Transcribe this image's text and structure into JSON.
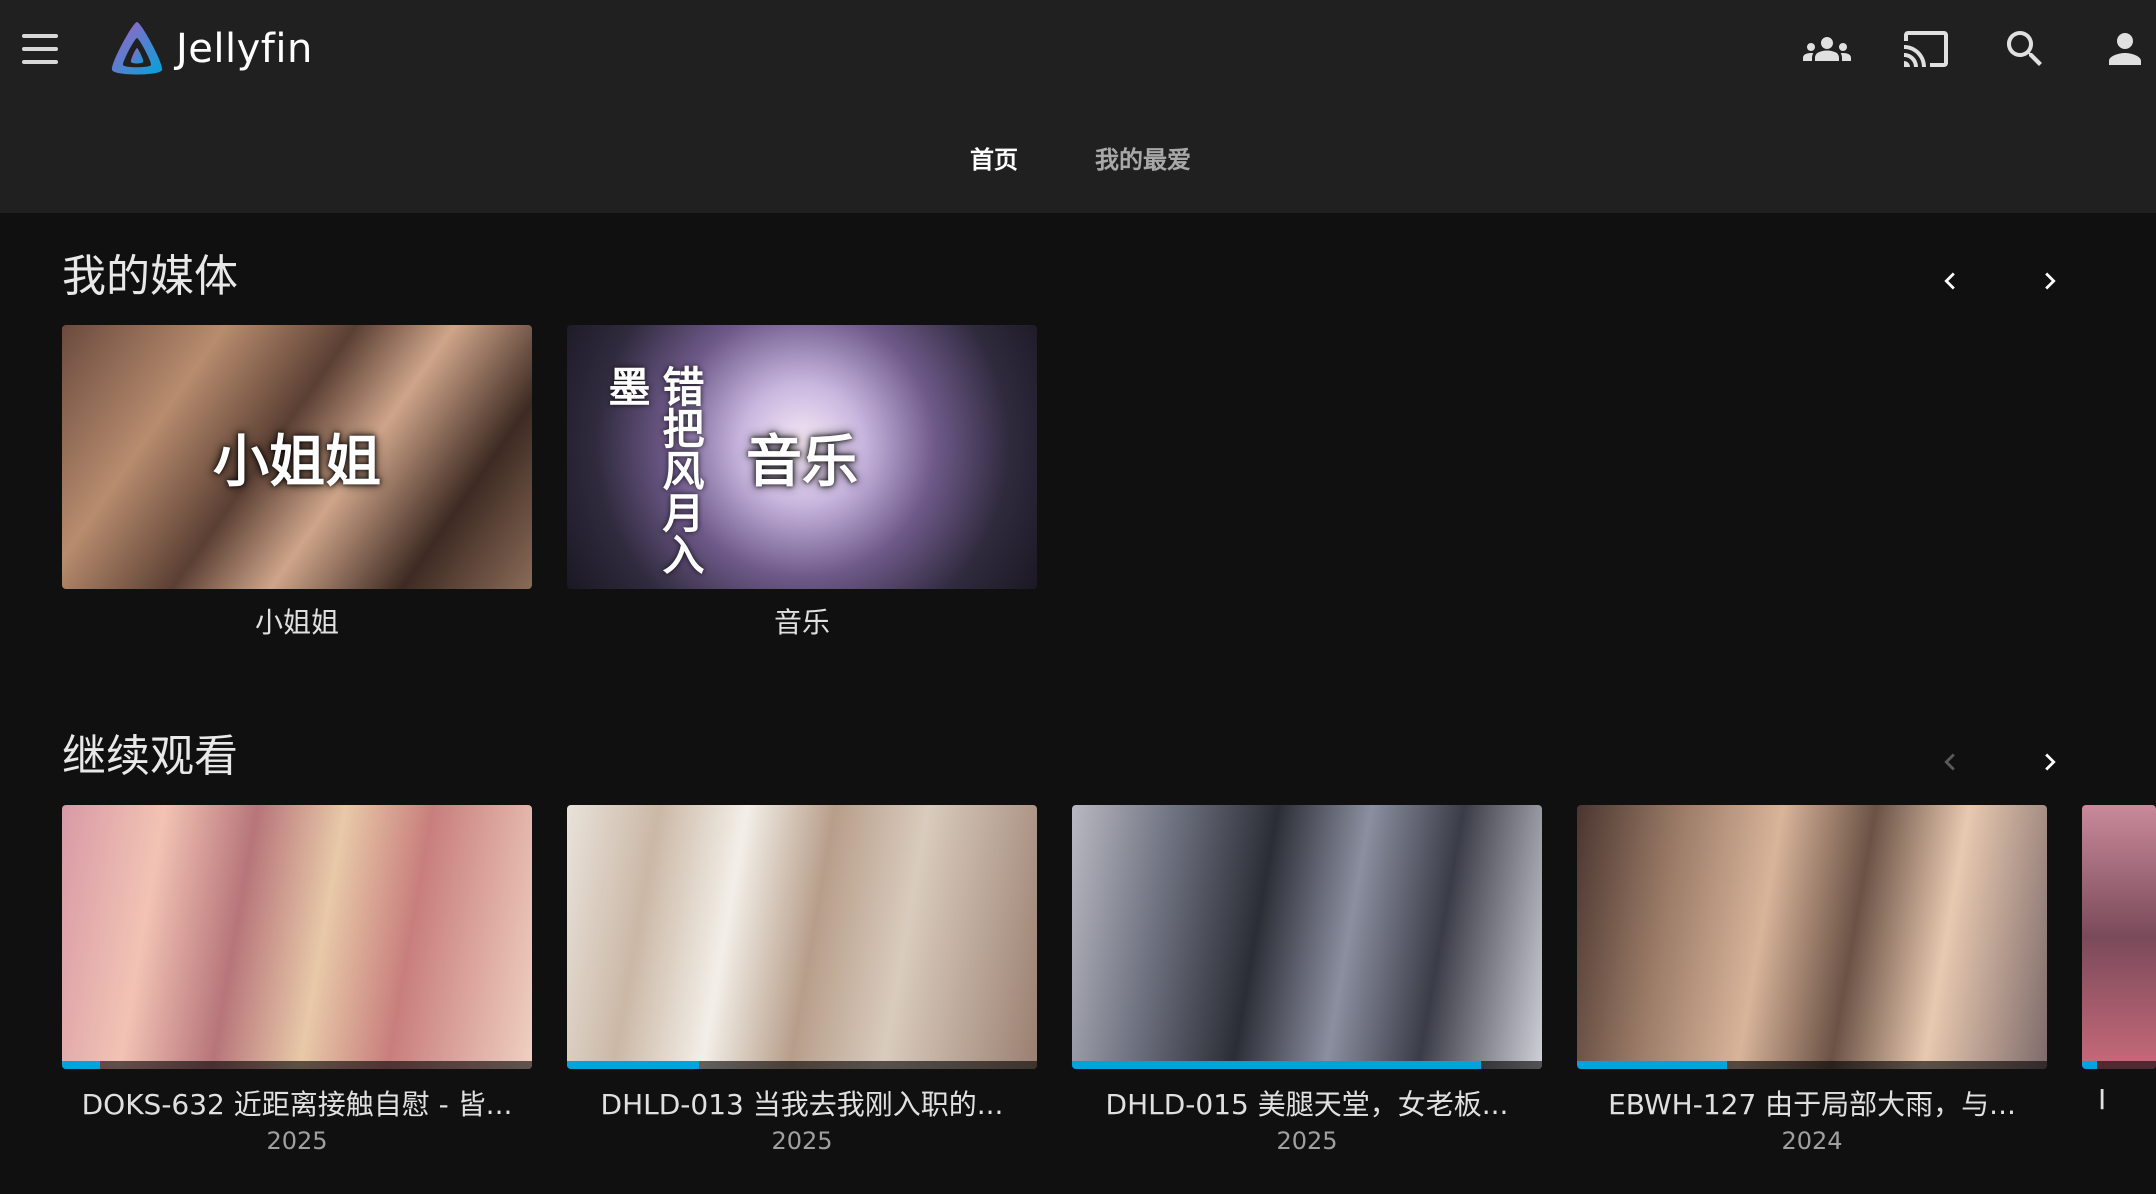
{
  "app": {
    "name": "Jellyfin",
    "brand_colors": [
      "#aa5cc3",
      "#00a4dc"
    ]
  },
  "header": {
    "icons": [
      "menu-icon",
      "people-icon",
      "cast-icon",
      "search-icon",
      "user-icon"
    ]
  },
  "tabs": [
    {
      "label": "首页",
      "active": true
    },
    {
      "label": "我的最爱",
      "active": false
    }
  ],
  "my_media": {
    "title": "我的媒体",
    "items": [
      {
        "label": "小姐姐",
        "overlay": "小姐姐"
      },
      {
        "label": "音乐",
        "overlay": "音乐",
        "cover_text": "错把风月入墨"
      }
    ]
  },
  "continue_watching": {
    "title": "继续观看",
    "items": [
      {
        "title": "DOKS-632 近距离接触自慰 - 皆...",
        "year": "2025",
        "progress": 0.08
      },
      {
        "title": "DHLD-013 当我去我刚入职的...",
        "year": "2025",
        "progress": 0.28
      },
      {
        "title": "DHLD-015 美腿天堂，女老板...",
        "year": "2025",
        "progress": 0.87
      },
      {
        "title": "EBWH-127 由于局部大雨，与...",
        "year": "2024",
        "progress": 0.32
      }
    ],
    "partial_item": {
      "title": "I"
    }
  }
}
